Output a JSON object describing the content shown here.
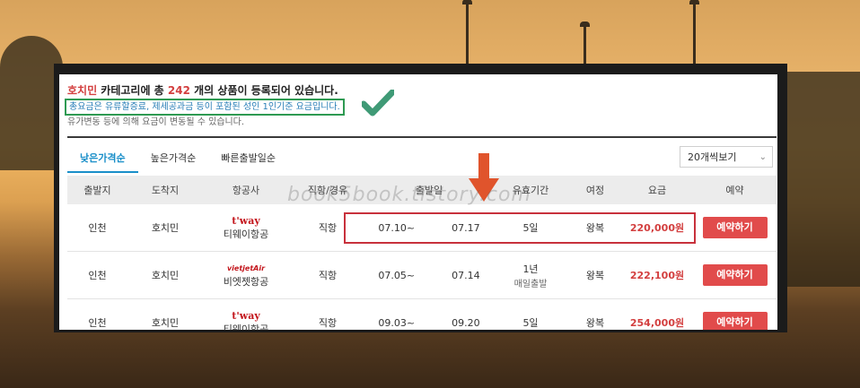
{
  "summary": {
    "city": "호치민",
    "text_a": " 카테고리에 총 ",
    "count": "242",
    "text_b": " 개의 상품이 등록되어 있습니다.",
    "note_highlight": "총요금은 유류할증료, 제세공과금 등이 포함된 성인 1인기준 요금입니다.",
    "note_secondary": "유가변동 등에 의해 요금이 변동될 수 있습니다."
  },
  "tabs": [
    {
      "label": "낮은가격순",
      "active": true
    },
    {
      "label": "높은가격순",
      "active": false
    },
    {
      "label": "빠른출발일순",
      "active": false
    }
  ],
  "per_page": {
    "value": "20개씩보기"
  },
  "table": {
    "headers": [
      "출발지",
      "도착지",
      "항공사",
      "직항/경유",
      "출발일",
      "유효기간",
      "여정",
      "요금",
      "예약"
    ],
    "rows": [
      {
        "origin": "인천",
        "destination": "호치민",
        "airline_logo": "t'way",
        "airline": "티웨이항공",
        "route": "직항",
        "depart": "07.10~",
        "return": "07.17",
        "validity": "5일",
        "validity_sub": "",
        "trip": "왕복",
        "fare": "220,000원",
        "reserve": "예약하기"
      },
      {
        "origin": "인천",
        "destination": "호치민",
        "airline_logo": "vietjetAir",
        "airline": "비엣젯항공",
        "route": "직항",
        "depart": "07.05~",
        "return": "07.14",
        "validity": "1년",
        "validity_sub": "매일출발",
        "trip": "왕복",
        "fare": "222,100원",
        "reserve": "예약하기"
      },
      {
        "origin": "인천",
        "destination": "호치민",
        "airline_logo": "t'way",
        "airline": "티웨이항공",
        "route": "직항",
        "depart": "09.03~",
        "return": "09.20",
        "validity": "5일",
        "validity_sub": "",
        "trip": "왕복",
        "fare": "254,000원",
        "reserve": "예약하기"
      }
    ]
  },
  "watermark": "book5book.tistory.com",
  "colors": {
    "accent_tab": "#1a8fc9",
    "price": "#d33f3f",
    "reserve_button": "#e14b4b",
    "note_border": "#2e9a52",
    "highlight_border": "#c8313c",
    "arrow": "#e0542c"
  }
}
